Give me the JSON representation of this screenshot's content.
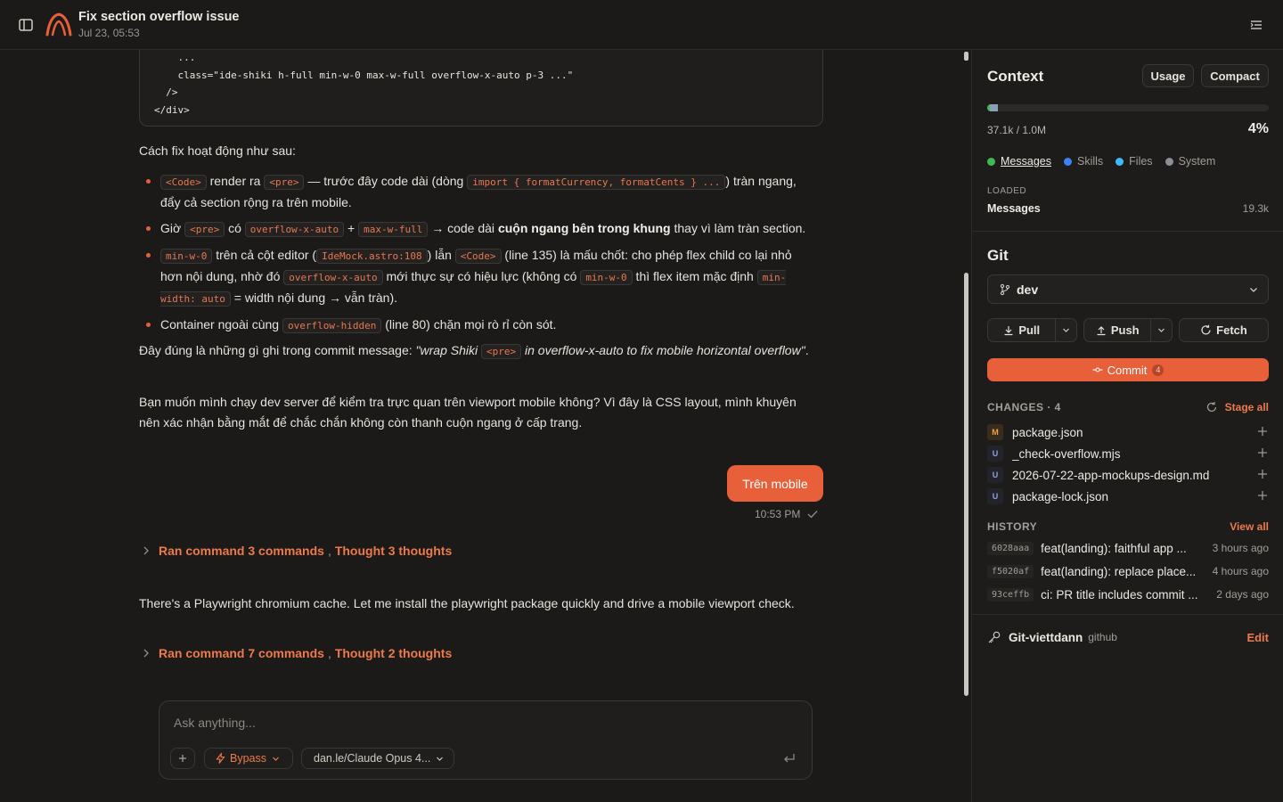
{
  "header": {
    "title": "Fix section overflow issue",
    "subtitle": "Jul 23, 05:53"
  },
  "chat": {
    "code_lines": [
      "    ...",
      "    class=\"ide-shiki h-full min-w-0 max-w-full overflow-x-auto p-3 ...\"",
      "  />",
      "</div>"
    ],
    "intro": "Cách fix hoạt động như sau:",
    "bullet1": {
      "c1": "<Code>",
      "t1": " render ra ",
      "c2": "<pre>",
      "t2": " — trước đây code dài (dòng ",
      "c3": "import { formatCurrency, formatCents } ...",
      "t3": ") tràn ngang, đẩy cả section rộng ra trên mobile."
    },
    "bullet2": {
      "t0": "Giờ ",
      "c1": "<pre>",
      "t1": " có ",
      "c2": "overflow-x-auto",
      "t2": " + ",
      "c3": "max-w-full",
      "t3": " → code dài ",
      "b1": "cuộn ngang bên trong khung",
      "t4": " thay vì làm tràn section."
    },
    "bullet3": {
      "c1": "min-w-0",
      "t1": " trên cả cột editor (",
      "c2": "IdeMock.astro:108",
      "t2": ") lẫn ",
      "c3": "<Code>",
      "t3": " (line 135) là mấu chốt: cho phép flex child co lại nhỏ hơn nội dung, nhờ đó ",
      "c4": "overflow-x-auto",
      "t4": " mới thực sự có hiệu lực (không có ",
      "c5": "min-w-0",
      "t5": " thì flex item mặc định ",
      "c6": "min-width: auto",
      "t6": " = width nội dung → vẫn tràn)."
    },
    "bullet4": {
      "t0": "Container ngoài cùng ",
      "c1": "overflow-hidden",
      "t1": " (line 80) chặn mọi rò rỉ còn sót."
    },
    "commit_para": {
      "t0": "Đây đúng là những gì ghi trong commit message: ",
      "i1": "\"wrap Shiki ",
      "c1": "<pre>",
      "i2": " in overflow-x-auto to fix mobile horizontal overflow\"",
      "t1": "."
    },
    "question": "Bạn muốn mình chạy dev server để kiểm tra trực quan trên viewport mobile không? Vì đây là CSS layout, mình khuyên nên xác nhận bằng mắt để chắc chắn không còn thanh cuộn ngang ở cấp trang.",
    "user_message": "Trên mobile",
    "user_time": "10:53 PM",
    "ran1": {
      "cmd": "Ran command 3 commands",
      "sep": ",",
      "thought": "Thought 3 thoughts"
    },
    "assistant_line": "There's a Playwright chromium cache. Let me install the playwright package quickly and drive a mobile viewport check.",
    "ran2": {
      "cmd": "Ran command 7 commands",
      "sep": ",",
      "thought": "Thought 2 thoughts"
    }
  },
  "composer": {
    "placeholder": "Ask anything...",
    "mode": "Bypass",
    "model": "dan.le/Claude Opus 4..."
  },
  "context": {
    "title": "Context",
    "usage_btn": "Usage",
    "compact_btn": "Compact",
    "count": "37.1k / 1.0M",
    "percent": "4%",
    "usage_fraction": 0.04,
    "legend": [
      {
        "label": "Messages",
        "color": "#3fb950"
      },
      {
        "label": "Skills",
        "color": "#3b82f6"
      },
      {
        "label": "Files",
        "color": "#38bdf8"
      },
      {
        "label": "System",
        "color": "#8b8f96"
      }
    ],
    "loaded_label": "LOADED",
    "loaded_name": "Messages",
    "loaded_value": "19.3k"
  },
  "git": {
    "title": "Git",
    "branch": "dev",
    "pull": "Pull",
    "push": "Push",
    "fetch": "Fetch",
    "commit": "Commit",
    "commit_count": "4",
    "changes_label": "CHANGES · 4",
    "stage_all": "Stage all",
    "files": [
      {
        "status": "M",
        "name": "package.json"
      },
      {
        "status": "U",
        "name": "_check-overflow.mjs"
      },
      {
        "status": "U",
        "name": "2026-07-22-app-mockups-design.md"
      },
      {
        "status": "U",
        "name": "package-lock.json"
      }
    ],
    "history_label": "HISTORY",
    "view_all": "View all",
    "history": [
      {
        "hash": "6028aaa",
        "message": "feat(landing): faithful app ...",
        "ago": "3 hours ago"
      },
      {
        "hash": "f5020af",
        "message": "feat(landing): replace place...",
        "ago": "4 hours ago"
      },
      {
        "hash": "93ceffb",
        "message": "ci: PR title includes commit ...",
        "ago": "2 days ago"
      }
    ],
    "account": "Git-viettdann",
    "account_provider": "github",
    "edit": "Edit"
  },
  "colors": {
    "accent": "#e8603a",
    "background": "#1b1a19",
    "panel": "#1d1c1b"
  }
}
